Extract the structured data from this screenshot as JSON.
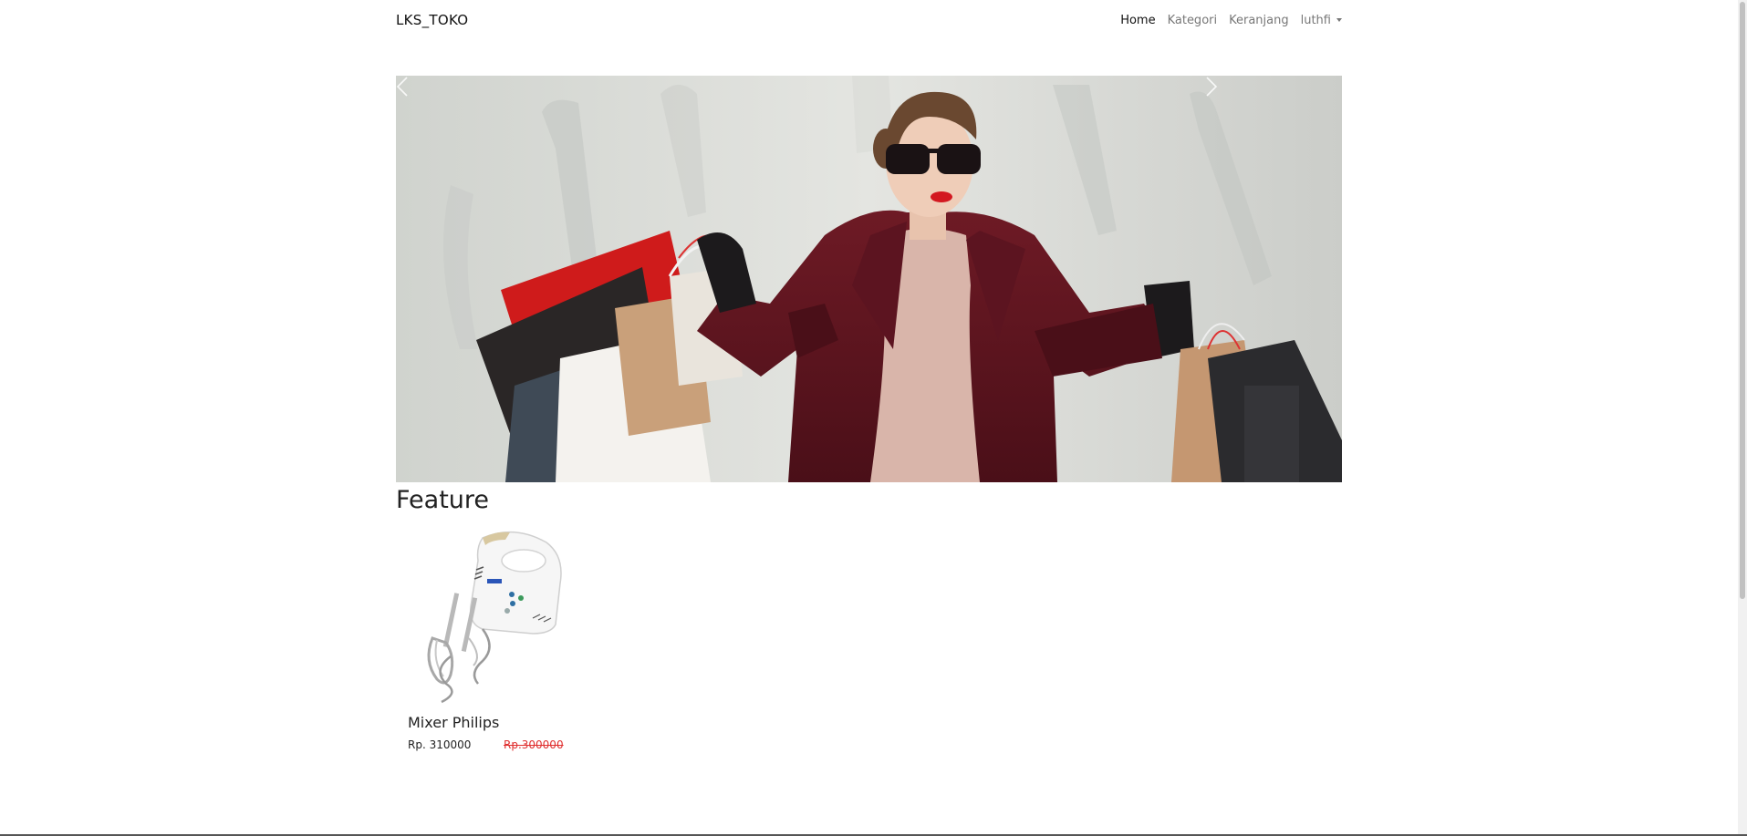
{
  "navbar": {
    "brand": "LKS_TOKO",
    "links": [
      {
        "label": "Home",
        "active": true
      },
      {
        "label": "Kategori",
        "active": false
      },
      {
        "label": "Keranjang",
        "active": false
      }
    ],
    "user_menu": {
      "label": "luthfi"
    }
  },
  "carousel": {
    "image": "shopping-woman-photo",
    "prev_icon": "chevron-left-icon",
    "next_icon": "chevron-right-icon"
  },
  "feature": {
    "title": "Feature",
    "products": [
      {
        "image": "hand-mixer-photo",
        "name": "Mixer Philips",
        "price": "Rp. 310000",
        "old_price": "Rp.300000"
      }
    ]
  },
  "colors": {
    "old_price": "#e03030",
    "text": "#212529",
    "nav_muted": "#777777"
  }
}
